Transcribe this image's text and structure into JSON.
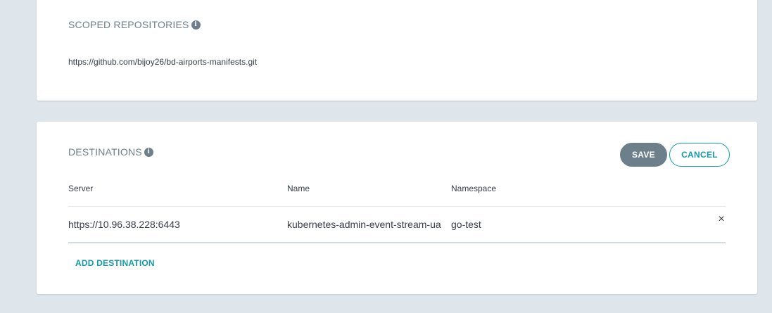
{
  "scoped_repositories": {
    "title": "SCOPED REPOSITORIES",
    "info_glyph": "i",
    "items": [
      "https://github.com/bijoy26/bd-airports-manifests.git"
    ]
  },
  "destinations": {
    "title": "DESTINATIONS",
    "info_glyph": "i",
    "save_label": "SAVE",
    "cancel_label": "CANCEL",
    "columns": [
      "Server",
      "Name",
      "Namespace"
    ],
    "rows": [
      {
        "server": "https://10.96.38.228:6443",
        "name": "kubernetes-admin-event-stream-ua",
        "namespace": "go-test",
        "remove_glyph": "×"
      }
    ],
    "add_label": "ADD DESTINATION"
  },
  "colors": {
    "background": "#dee6eb",
    "card": "#ffffff",
    "muted": "#6d7f8b",
    "accent": "#139bab",
    "text": "#363c4a"
  }
}
